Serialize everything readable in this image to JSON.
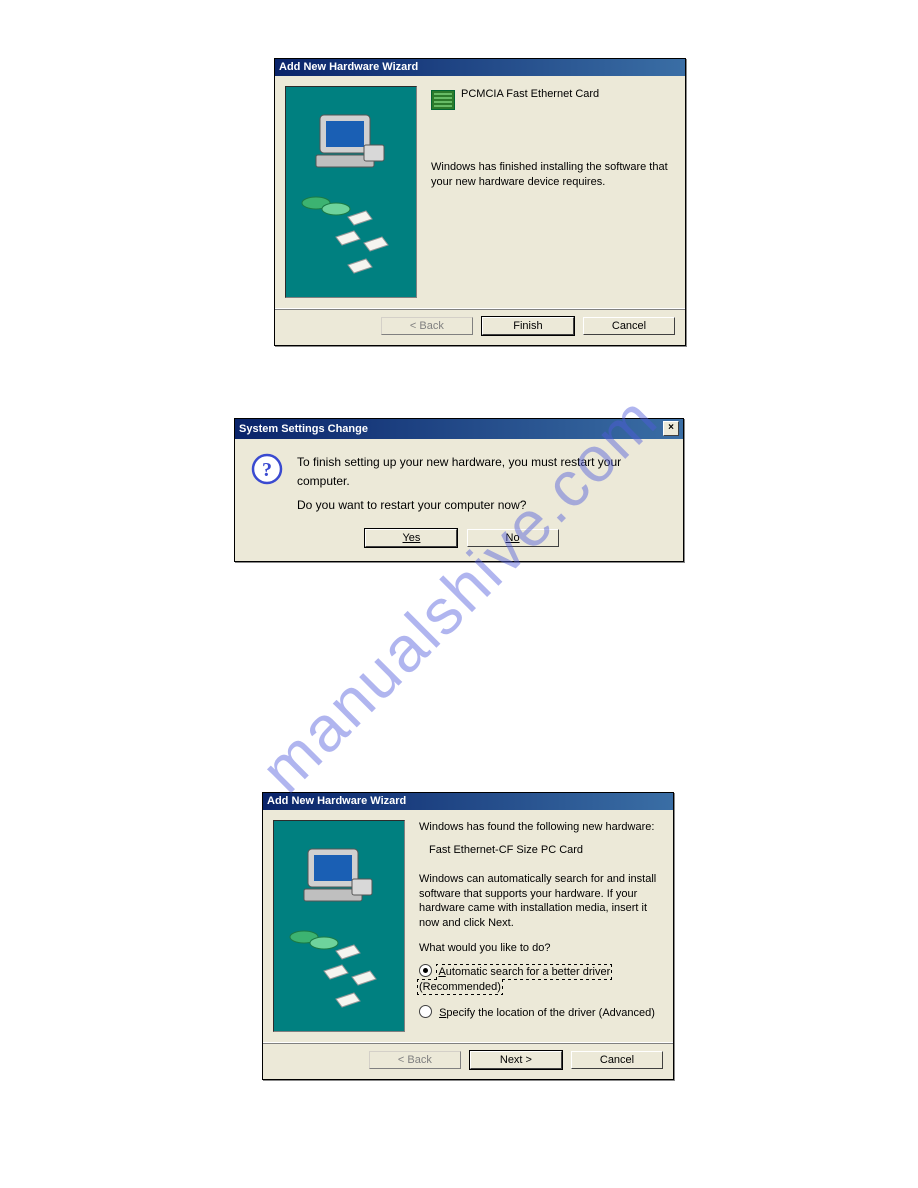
{
  "watermark": "manualshive.com",
  "dlg1": {
    "title": "Add New Hardware Wizard",
    "device": "PCMCIA Fast Ethernet Card",
    "body": "Windows has finished installing the software that your new hardware device requires.",
    "back": "< Back",
    "finish": "Finish",
    "cancel": "Cancel"
  },
  "dlg2": {
    "title": "System Settings Change",
    "line1": "To finish setting up your new hardware, you must restart your computer.",
    "line2": "Do you want to restart your computer now?",
    "yes": "Yes",
    "no": "No"
  },
  "dlg3": {
    "title": "Add New Hardware Wizard",
    "found": "Windows has found the following new hardware:",
    "device": "Fast Ethernet-CF Size PC Card",
    "auto": "Windows can automatically search for and install software that supports your hardware. If your hardware came with installation media, insert it now and click Next.",
    "prompt": "What would you like to do?",
    "opt1": "Automatic search for a better driver (Recommended)",
    "opt2": "Specify the location of the driver (Advanced)",
    "back": "< Back",
    "next": "Next >",
    "cancel": "Cancel"
  }
}
